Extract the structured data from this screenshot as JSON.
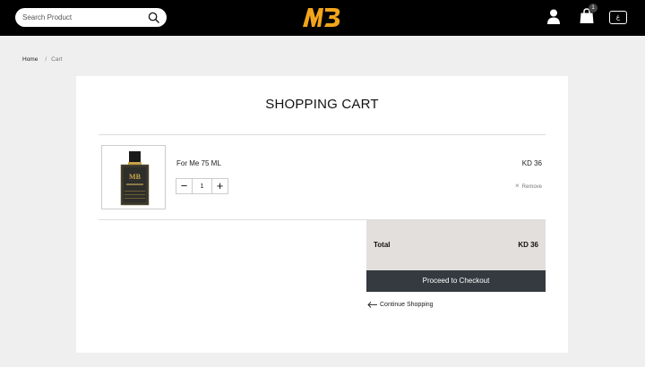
{
  "header": {
    "search": {
      "placeholder": "Search Product",
      "value": ""
    },
    "brand_logo": "MB",
    "cart_count": "1",
    "language_label": "ع",
    "accent_color": "#f2a51a"
  },
  "breadcrumb": {
    "home": "Home",
    "separator": "/",
    "current": "Cart"
  },
  "cart": {
    "title": "SHOPPING CART",
    "items": [
      {
        "name": "For Me 75 ML",
        "price": "KD 36",
        "quantity": "1",
        "remove_label": "Remove",
        "image_label": "MB"
      }
    ],
    "total_label": "Total",
    "total_amount": "KD 36",
    "checkout_label": "Proceed to Checkout",
    "continue_label": "Continue Shopping"
  }
}
